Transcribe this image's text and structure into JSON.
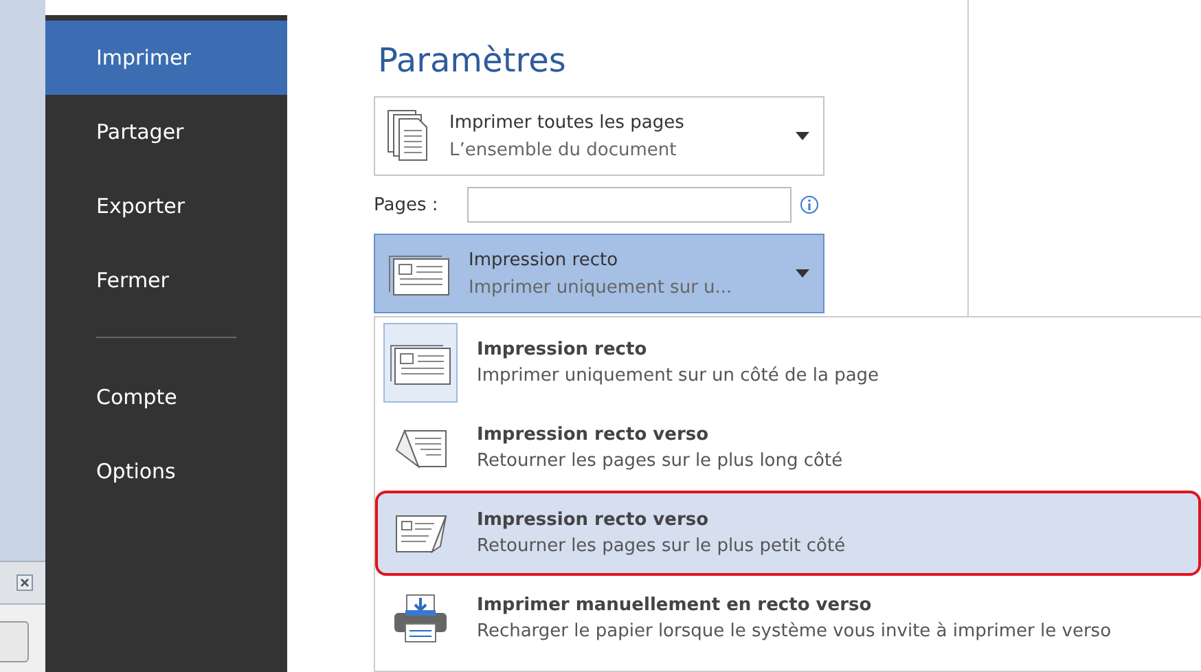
{
  "sidebar": {
    "items_top": [
      {
        "label": "Imprimer",
        "selected": true
      },
      {
        "label": "Partager",
        "selected": false
      },
      {
        "label": "Exporter",
        "selected": false
      },
      {
        "label": "Fermer",
        "selected": false
      }
    ],
    "items_bottom": [
      {
        "label": "Compte",
        "selected": false
      },
      {
        "label": "Options",
        "selected": false
      }
    ]
  },
  "settings": {
    "title": "Paramètres",
    "print_range": {
      "kind": "pages",
      "title": "Imprimer toutes les pages",
      "subtitle": "L’ensemble du document"
    },
    "pages": {
      "label": "Pages :"
    },
    "sides": {
      "kind": "recto",
      "title": "Impression recto",
      "subtitle": "Imprimer uniquement sur u..."
    },
    "options": [
      {
        "kind": "recto",
        "title": "Impression recto",
        "subtitle": "Imprimer uniquement sur un côté de la page",
        "selected": true,
        "highlighted": false
      },
      {
        "kind": "long",
        "title": "Impression recto verso",
        "subtitle": "Retourner les pages sur le plus long côté",
        "selected": false,
        "highlighted": false
      },
      {
        "kind": "short",
        "title": "Impression recto verso",
        "subtitle": "Retourner les pages sur le plus petit côté",
        "selected": false,
        "highlighted": true
      },
      {
        "kind": "manual",
        "title": "Imprimer manuellement en recto verso",
        "subtitle": "Recharger le papier lorsque le système vous invite à imprimer le verso",
        "selected": false,
        "highlighted": false
      }
    ]
  }
}
